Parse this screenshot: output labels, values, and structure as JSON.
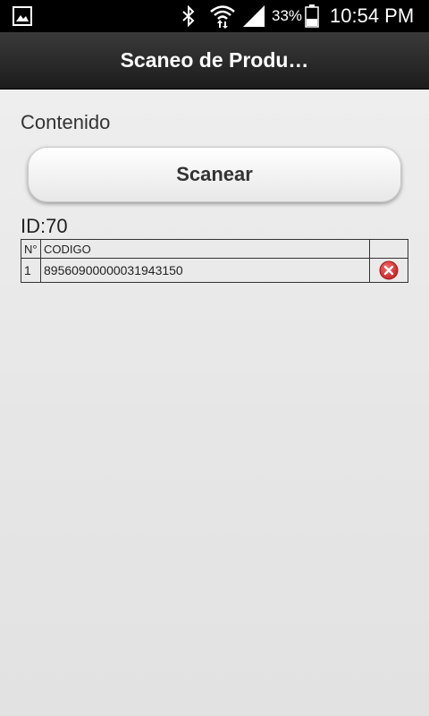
{
  "status_bar": {
    "battery_percent": "33%",
    "time": "10:54 PM",
    "icons": [
      "gallery-notification-icon",
      "bluetooth-icon",
      "wifi-icon",
      "signal-icon",
      "battery-icon"
    ]
  },
  "header": {
    "title": "Scaneo de Produ…"
  },
  "main": {
    "content_label": "Contenido",
    "scan_button_label": "Scanear",
    "id_label": "ID:70"
  },
  "table": {
    "headers": [
      "N°",
      "CODIGO",
      ""
    ],
    "rows": [
      {
        "n": "1",
        "codigo": "89560900000031943150",
        "action_icon": "delete-icon"
      }
    ]
  },
  "colors": {
    "header_bg": "#1c1c1c",
    "status_bg": "#000000",
    "delete_red": "#d32f2f"
  }
}
